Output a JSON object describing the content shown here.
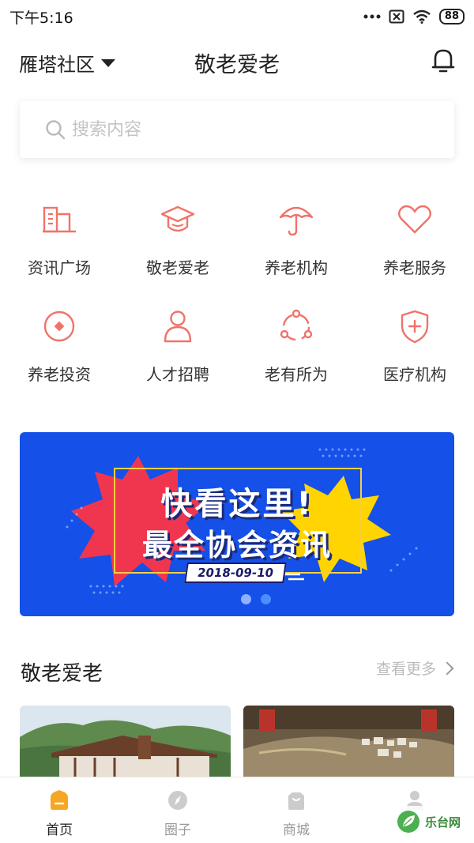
{
  "status_bar": {
    "time": "下午5:16",
    "battery": "88"
  },
  "header": {
    "community": "雁塔社区",
    "title": "敬老爱老"
  },
  "search": {
    "placeholder": "搜索内容"
  },
  "grid": [
    {
      "label": "资讯广场",
      "icon": "building-icon"
    },
    {
      "label": "敬老爱老",
      "icon": "graduation-cap-icon"
    },
    {
      "label": "养老机构",
      "icon": "umbrella-icon"
    },
    {
      "label": "养老服务",
      "icon": "heart-icon"
    },
    {
      "label": "养老投资",
      "icon": "target-icon"
    },
    {
      "label": "人才招聘",
      "icon": "person-icon"
    },
    {
      "label": "老有所为",
      "icon": "network-icon"
    },
    {
      "label": "医疗机构",
      "icon": "shield-plus-icon"
    }
  ],
  "banner": {
    "line1": "快看这里!",
    "line2": "最全协会资讯",
    "date": "2018-09-10",
    "slide_count": 2,
    "active_slide": 2
  },
  "section": {
    "title": "敬老爱老",
    "more": "查看更多"
  },
  "tabs": [
    {
      "label": "首页",
      "icon": "home-icon",
      "active": true
    },
    {
      "label": "圈子",
      "icon": "compass-icon",
      "active": false
    },
    {
      "label": "商城",
      "icon": "shop-bag-icon",
      "active": false
    },
    {
      "label": "",
      "icon": "profile-icon",
      "active": false
    }
  ],
  "watermark": {
    "text": "乐台网"
  },
  "colors": {
    "accent": "#f0736a",
    "banner_bg": "#1550e8",
    "active_tab": "#f5a623",
    "inactive": "#cccccc"
  }
}
